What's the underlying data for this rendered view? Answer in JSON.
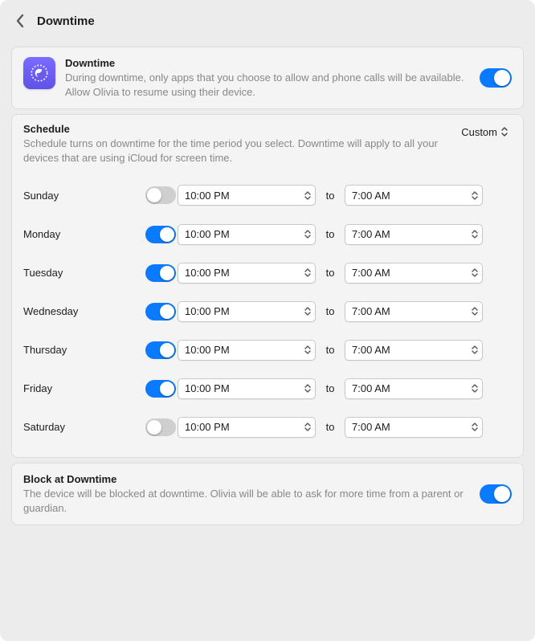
{
  "header": {
    "title": "Downtime"
  },
  "downtime_card": {
    "icon": "moon-clock-icon",
    "title": "Downtime",
    "description": "During downtime, only apps that you choose to allow and phone calls will be available. Allow Olivia to resume using their device.",
    "enabled": true
  },
  "schedule": {
    "title": "Schedule",
    "description": "Schedule turns on downtime for the time period you select. Downtime will apply to all your devices that are using iCloud for screen time.",
    "mode_label": "Custom",
    "to_label": "to",
    "days": [
      {
        "name": "Sunday",
        "enabled": false,
        "from": "10:00 PM",
        "to": "7:00 AM"
      },
      {
        "name": "Monday",
        "enabled": true,
        "from": "10:00 PM",
        "to": "7:00 AM"
      },
      {
        "name": "Tuesday",
        "enabled": true,
        "from": "10:00 PM",
        "to": "7:00 AM"
      },
      {
        "name": "Wednesday",
        "enabled": true,
        "from": "10:00 PM",
        "to": "7:00 AM"
      },
      {
        "name": "Thursday",
        "enabled": true,
        "from": "10:00 PM",
        "to": "7:00 AM"
      },
      {
        "name": "Friday",
        "enabled": true,
        "from": "10:00 PM",
        "to": "7:00 AM"
      },
      {
        "name": "Saturday",
        "enabled": false,
        "from": "10:00 PM",
        "to": "7:00 AM"
      }
    ]
  },
  "block": {
    "title": "Block at Downtime",
    "description": "The device will be blocked at downtime. Olivia will be able to ask for more time from a parent or guardian.",
    "enabled": true
  }
}
